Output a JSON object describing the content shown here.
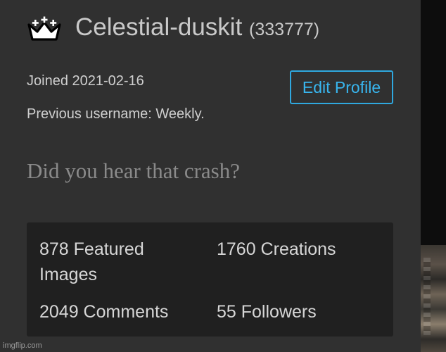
{
  "profile": {
    "username": "Celestial-duskit",
    "user_id": "(333777)",
    "joined": "Joined 2021-02-16",
    "previous_username": "Previous username: Weekly.",
    "edit_button": "Edit Profile",
    "bio": "Did you hear that crash?"
  },
  "stats": {
    "featured": "878 Featured Images",
    "creations": "1760 Creations",
    "comments": "2049 Comments",
    "followers": "55 Followers"
  },
  "icons": {
    "crown": "crown-icon"
  },
  "colors": {
    "background": "#303030",
    "stats_background": "#202020",
    "accent": "#38b6ef",
    "username_text": "#c9c9c9",
    "bio_text": "#8a8a8a"
  },
  "watermark": "imgflip.com"
}
